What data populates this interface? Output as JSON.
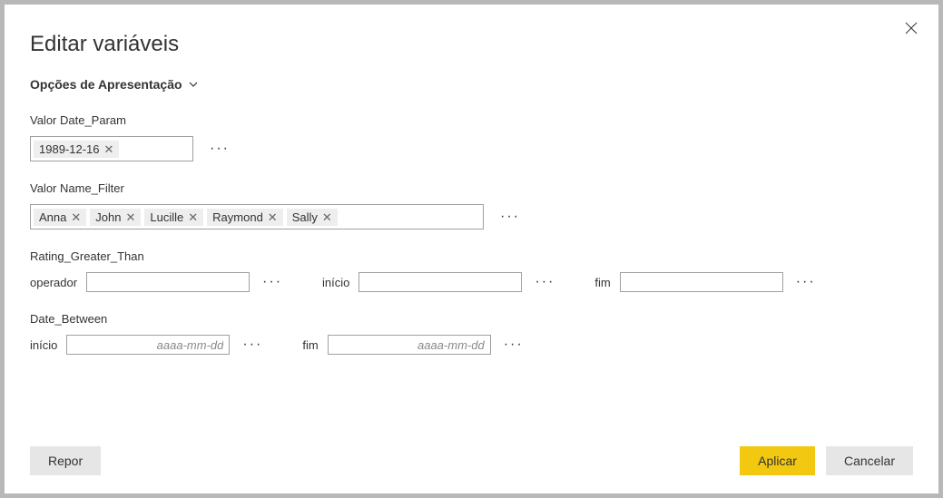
{
  "dialog": {
    "title": "Editar variáveis",
    "display_options_label": "Opções de Apresentação"
  },
  "fields": {
    "date_param": {
      "label": "Valor Date_Param",
      "tags": [
        "1989-12-16"
      ]
    },
    "name_filter": {
      "label": "Valor Name_Filter",
      "tags": [
        "Anna",
        "John",
        "Lucille",
        "Raymond",
        "Sally"
      ]
    },
    "rating_greater": {
      "label": "Rating_Greater_Than",
      "operator_label": "operador",
      "start_label": "início",
      "end_label": "fim"
    },
    "date_between": {
      "label": "Date_Between",
      "start_label": "início",
      "end_label": "fim",
      "placeholder": "aaaa-mm-dd"
    }
  },
  "buttons": {
    "reset": "Repor",
    "apply": "Aplicar",
    "cancel": "Cancelar"
  },
  "more_dots": "···"
}
